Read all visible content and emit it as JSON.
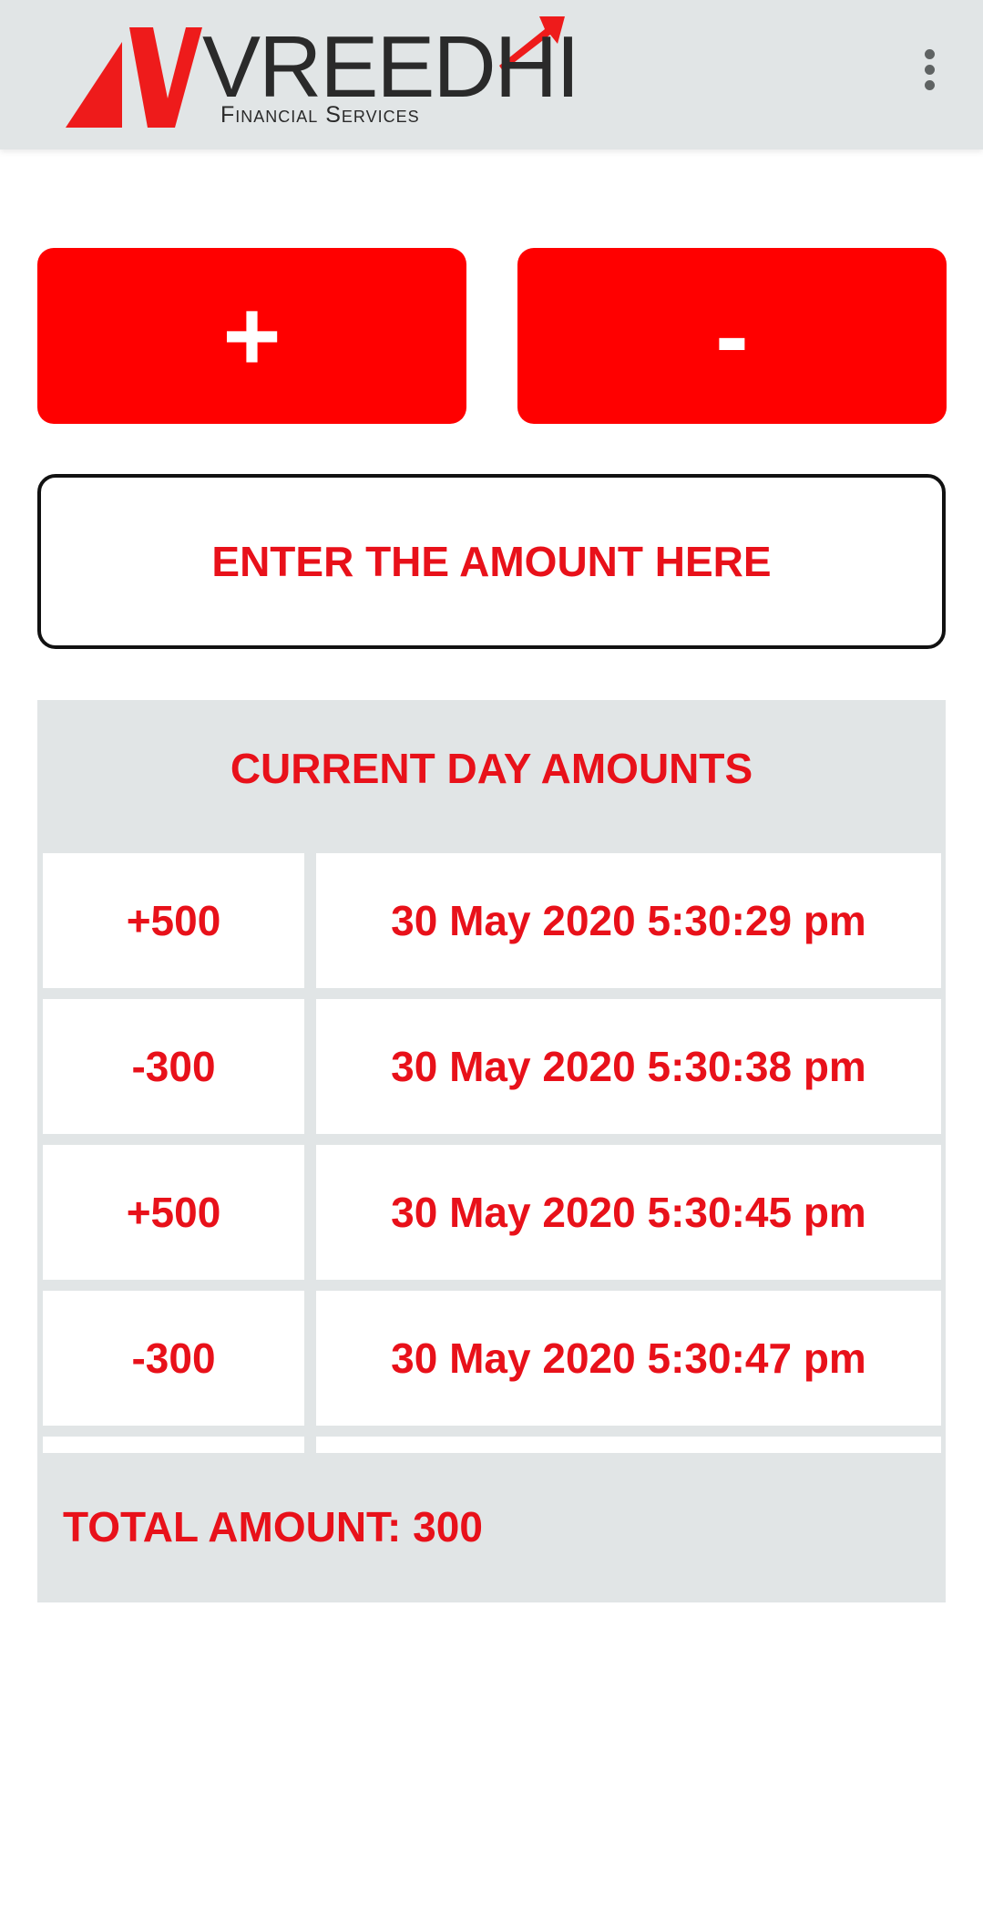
{
  "header": {
    "logo_text": "VREEDHI",
    "logo_subtitle": "Financial Services",
    "menu_icon": "more-vert-icon"
  },
  "actions": {
    "plus_label": "+",
    "minus_label": "-"
  },
  "amount_input": {
    "placeholder": "ENTER THE AMOUNT HERE",
    "value": ""
  },
  "day_amounts": {
    "title": "CURRENT DAY AMOUNTS",
    "entries": [
      {
        "amount": "+500",
        "timestamp": "30 May 2020 5:30:29 pm"
      },
      {
        "amount": "-300",
        "timestamp": "30 May 2020 5:30:38 pm"
      },
      {
        "amount": "+500",
        "timestamp": "30 May 2020 5:30:45 pm"
      },
      {
        "amount": "-300",
        "timestamp": "30 May 2020 5:30:47 pm"
      },
      {
        "amount": "",
        "timestamp": ""
      }
    ],
    "total_label": "TOTAL AMOUNT: 300"
  },
  "colors": {
    "accent": "#ff0000",
    "text_red": "#e8111a",
    "panel_bg": "#e1e5e6",
    "toolbar_bg": "#e1e5e6"
  }
}
